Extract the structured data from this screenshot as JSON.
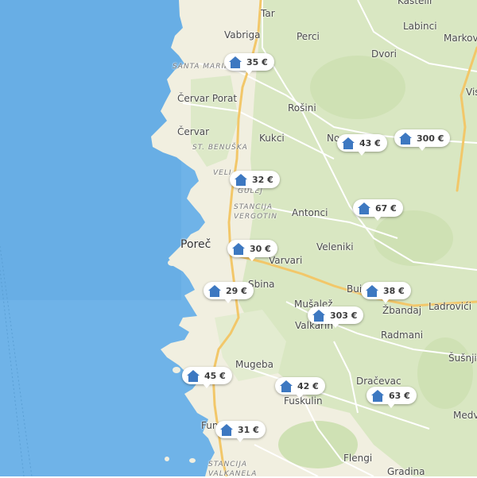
{
  "colors": {
    "sea": "#6fb3e8",
    "land": "#f1efe0",
    "green": "#d6e6bd",
    "road": "#f2c769",
    "minor_road": "#ffffff",
    "marker_icon": "#3d78c1"
  },
  "places": {
    "tar": "Tar",
    "kasteli": "Kastelir",
    "vabriga": "Vabriga",
    "perci": "Perci",
    "labinci": "Labinci",
    "markovac": "Markov",
    "santa_marina": "Santa Marina",
    "dvori": "Dvori",
    "cervar_porat": "Červar Porat",
    "rosini": "Rošini",
    "vis": "Vis",
    "cervar": "Červar",
    "kukci": "Kukci",
    "no": "No",
    "st_benuska": "St. Benuška",
    "veli": "Veli",
    "gulej": "Gulej",
    "stancija_vergotin_1": "Stancija",
    "stancija_vergotin_2": "Vergotin",
    "antonci": "Antonci",
    "porec": "Poreč",
    "veleniki": "Veleniki",
    "varvari": "Varvari",
    "sbina": "Sbina",
    "bui": "Bui",
    "musalez": "Mušalež",
    "zbandaj": "Žbandaj",
    "ladrovici": "Ladrovići",
    "valkarin": "Valkarin",
    "radmani": "Radmani",
    "susnjici": "Šušnji",
    "mugeba": "Mugeba",
    "dracevac": "Dračevac",
    "fuskulin": "Fuskulin",
    "medv": "Medv",
    "fun": "Fun",
    "flengi": "Flengi",
    "stancija_valkanela_1": "Stancija",
    "stancija_valkanela_2": "Valkanela",
    "gradina": "Gradina"
  },
  "markers": [
    {
      "price": "35 €"
    },
    {
      "price": "43 €"
    },
    {
      "price": "300 €"
    },
    {
      "price": "32 €"
    },
    {
      "price": "67 €"
    },
    {
      "price": "30 €"
    },
    {
      "price": "29 €"
    },
    {
      "price": "38 €"
    },
    {
      "price": "303 €"
    },
    {
      "price": "45 €"
    },
    {
      "price": "42 €"
    },
    {
      "price": "63 €"
    },
    {
      "price": "31 €"
    }
  ]
}
